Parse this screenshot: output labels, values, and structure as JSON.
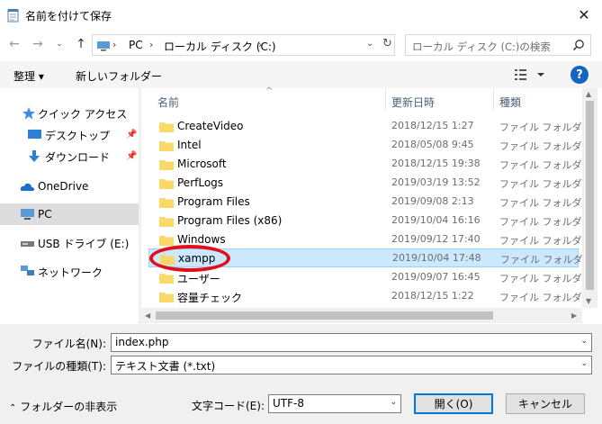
{
  "window": {
    "title": "名前を付けて保存"
  },
  "address": {
    "breadcrumbs": [
      "PC",
      "ローカル ディスク (C:)"
    ],
    "search_placeholder": "ローカル ディスク (C:)の検索"
  },
  "toolbar": {
    "organize": "整理 ▾",
    "new_folder": "新しいフォルダー"
  },
  "nav": {
    "items": [
      {
        "label": "クイック アクセス",
        "icon": "star-icon"
      },
      {
        "label": "デスクトップ",
        "icon": "desktop-icon",
        "pinned": true
      },
      {
        "label": "ダウンロード",
        "icon": "download-icon",
        "pinned": true
      },
      {
        "label": "OneDrive",
        "icon": "cloud-icon"
      },
      {
        "label": "PC",
        "icon": "pc-icon",
        "selected": true
      },
      {
        "label": "USB ドライブ (E:)",
        "icon": "usb-drive-icon"
      },
      {
        "label": "ネットワーク",
        "icon": "network-icon"
      }
    ]
  },
  "files": {
    "columns": [
      "名前",
      "更新日時",
      "種類"
    ],
    "rows": [
      {
        "name": "CreateVideo",
        "date": "2018/12/15 1:27",
        "type": "ファイル フォルダー"
      },
      {
        "name": "Intel",
        "date": "2018/05/08 9:45",
        "type": "ファイル フォルダー"
      },
      {
        "name": "Microsoft",
        "date": "2018/12/15 19:38",
        "type": "ファイル フォルダー"
      },
      {
        "name": "PerfLogs",
        "date": "2019/03/19 13:52",
        "type": "ファイル フォルダー"
      },
      {
        "name": "Program Files",
        "date": "2019/09/08 2:13",
        "type": "ファイル フォルダー"
      },
      {
        "name": "Program Files (x86)",
        "date": "2019/10/04 16:16",
        "type": "ファイル フォルダー"
      },
      {
        "name": "Windows",
        "date": "2019/09/12 17:40",
        "type": "ファイル フォルダー"
      },
      {
        "name": "xampp",
        "date": "2019/10/04 17:48",
        "type": "ファイル フォルダー",
        "selected": true
      },
      {
        "name": "ユーザー",
        "date": "2019/09/07 16:45",
        "type": "ファイル フォルダー"
      },
      {
        "name": "容量チェック",
        "date": "2018/12/15 1:22",
        "type": "ファイル フォルダー"
      }
    ]
  },
  "form": {
    "filename_label": "ファイル名(N):",
    "filename_value": "index.php",
    "filetype_label": "ファイルの種類(T):",
    "filetype_value": "テキスト文書 (*.txt)",
    "encoding_label": "文字コード(E):",
    "encoding_value": "UTF-8",
    "open_button": "開く(O)",
    "cancel_button": "キャンセル",
    "hide_folders": "フォルダーの非表示"
  },
  "colors": {
    "accent": "#0078d7",
    "highlight": "#e0101a",
    "selection": "#cce8ff",
    "folder": "#f8d775"
  }
}
